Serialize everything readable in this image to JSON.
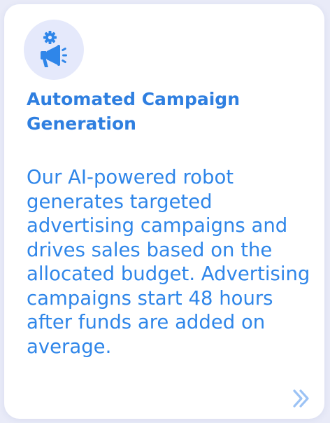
{
  "card": {
    "icon": "megaphone-gear-icon",
    "title": "Automated Campaign Generation",
    "description": "Our AI-powered robot generates targeted advertising campaigns and drives sales based on the allocated budget. Advertising campaigns start 48 hours after funds are added on average.",
    "more_icon": "double-chevron-right-icon"
  },
  "colors": {
    "accent": "#2f7fe0",
    "icon_circle": "#e5e9fb",
    "icon_fill": "#2f86e9",
    "arrow": "#9cc3f5",
    "background": "#e9ebf8"
  }
}
